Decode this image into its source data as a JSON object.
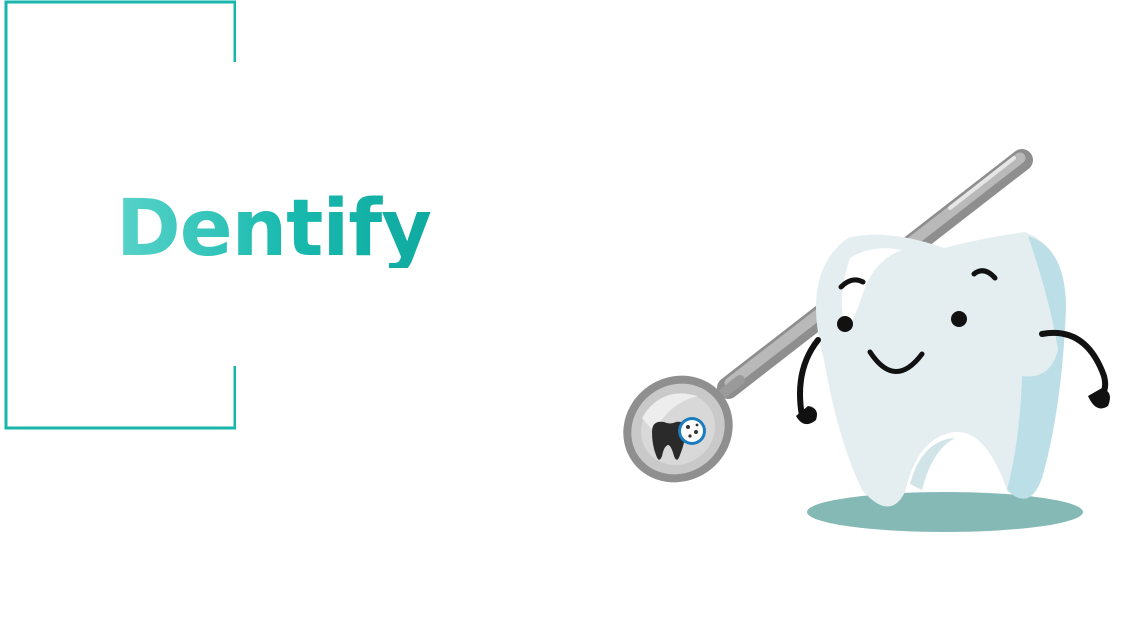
{
  "title": "Dentify",
  "colors": {
    "accent": "#17b6ab",
    "tooth": "#e4eef1",
    "tooth_shadow": "#bcdfe7",
    "ground_shadow": "#85b9b6",
    "instrument": "#a8a8a8"
  },
  "icons": {
    "bracket": "bracket-frame",
    "mascot": "tooth-mascot",
    "tool": "dental-mirror"
  }
}
